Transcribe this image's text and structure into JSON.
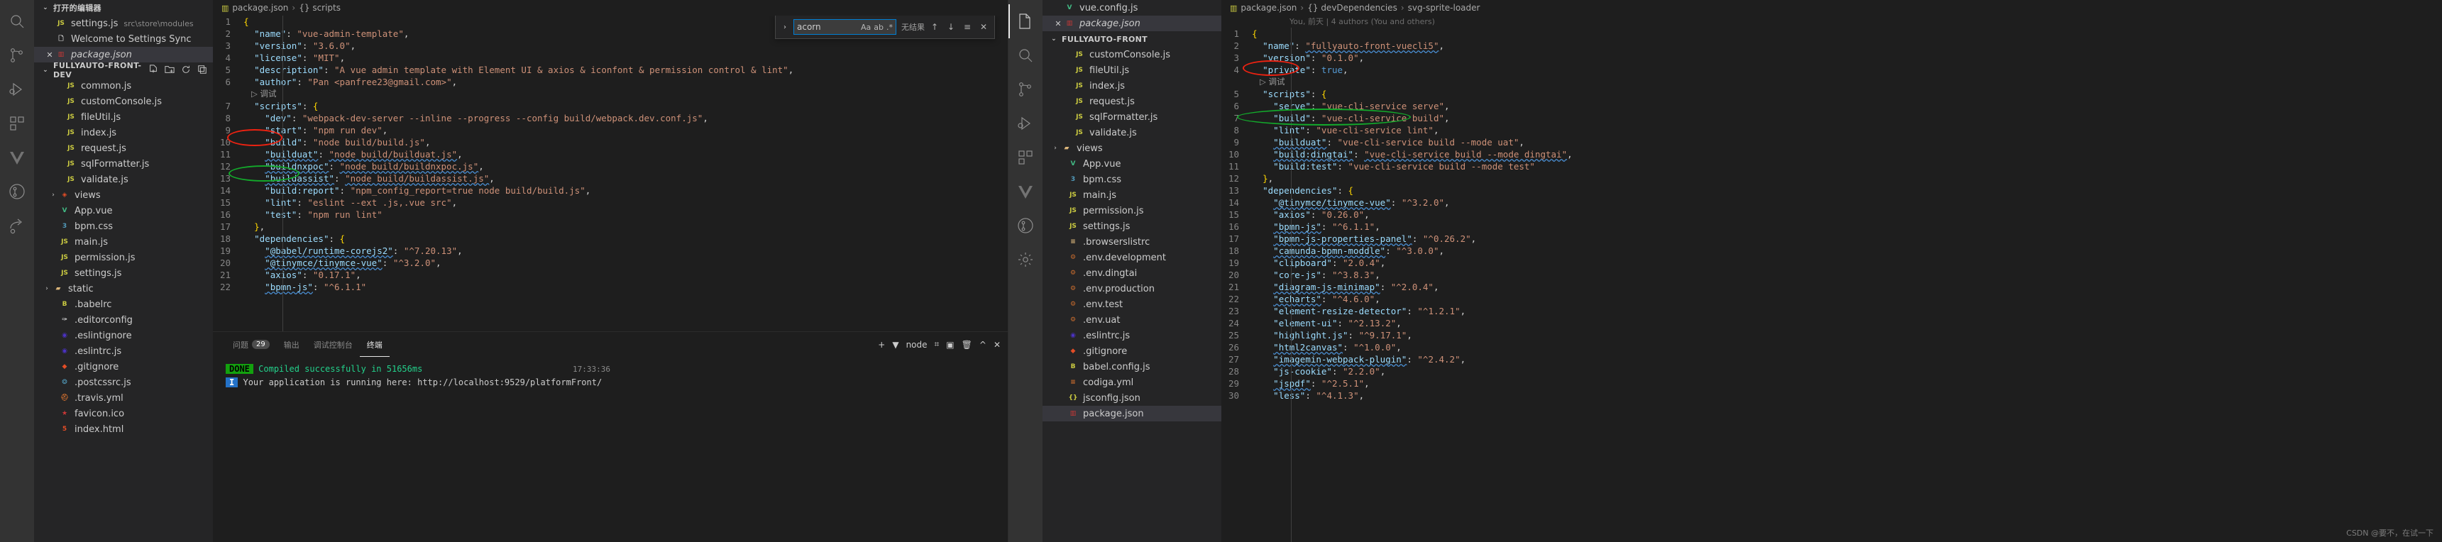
{
  "window_left": {
    "activity_icons": [
      "search-icon",
      "source-control-icon",
      "run-debug-icon",
      "extensions-icon",
      "vue-icon",
      "git-graph-icon",
      "share-icon"
    ],
    "explorer": {
      "open_editors_label": "打开的编辑器",
      "open_editors": [
        {
          "icon": "js-file-icon",
          "label": "settings.js",
          "detail": "src\\store\\modules",
          "selected": false,
          "close": ""
        },
        {
          "icon": "file-icon",
          "label": "Welcome to Settings Sync",
          "detail": "",
          "selected": false,
          "close": ""
        },
        {
          "icon": "npm-file-icon",
          "label": "package.json",
          "detail": "",
          "selected": true,
          "close": "✕",
          "italic": true
        }
      ],
      "project_label": "FULLYAUTO-FRONT-DEV",
      "files": [
        {
          "icon": "js-file-icon",
          "label": "common.js",
          "indent": 2
        },
        {
          "icon": "js-file-icon",
          "label": "customConsole.js",
          "indent": 2
        },
        {
          "icon": "js-file-icon",
          "label": "fileUtil.js",
          "indent": 2
        },
        {
          "icon": "js-file-icon",
          "label": "index.js",
          "indent": 2
        },
        {
          "icon": "js-file-icon",
          "label": "request.js",
          "indent": 2
        },
        {
          "icon": "js-file-icon",
          "label": "sqlFormatter.js",
          "indent": 2
        },
        {
          "icon": "js-file-icon",
          "label": "validate.js",
          "indent": 2
        },
        {
          "icon": "vue-folder-icon",
          "label": "views",
          "indent": 1,
          "chevron": "›"
        },
        {
          "icon": "vue-file-icon",
          "label": "App.vue",
          "indent": 1
        },
        {
          "icon": "css-file-icon",
          "label": "bpm.css",
          "indent": 1
        },
        {
          "icon": "js-file-icon",
          "label": "main.js",
          "indent": 1
        },
        {
          "icon": "js-file-icon",
          "label": "permission.js",
          "indent": 1
        },
        {
          "icon": "js-file-icon",
          "label": "settings.js",
          "indent": 1
        },
        {
          "icon": "folder-icon",
          "label": "static",
          "indent": 0,
          "chevron": "›"
        },
        {
          "icon": "babel-icon",
          "label": ".babelrc",
          "indent": 1
        },
        {
          "icon": "editorconfig-icon",
          "label": ".editorconfig",
          "indent": 1
        },
        {
          "icon": "eslint-icon",
          "label": ".eslintignore",
          "indent": 1
        },
        {
          "icon": "eslint-icon",
          "label": ".eslintrc.js",
          "indent": 1
        },
        {
          "icon": "git-icon",
          "label": ".gitignore",
          "indent": 1
        },
        {
          "icon": "postcss-icon",
          "label": ".postcssrc.js",
          "indent": 1
        },
        {
          "icon": "travis-icon",
          "label": ".travis.yml",
          "indent": 1
        },
        {
          "icon": "favicon-icon",
          "label": "favicon.ico",
          "indent": 1
        },
        {
          "icon": "html-icon",
          "label": "index.html",
          "indent": 1
        }
      ]
    },
    "editor": {
      "breadcrumb_file": "package.json",
      "breadcrumb_sep": "›",
      "breadcrumb_scope": "{} scripts",
      "codelens": "调试",
      "lines": [
        {
          "n": 1,
          "text": "{"
        },
        {
          "n": 2,
          "text": "  \"name\": \"vue-admin-template\","
        },
        {
          "n": 3,
          "text": "  \"version\": \"3.6.0\","
        },
        {
          "n": 4,
          "text": "  \"license\": \"MIT\","
        },
        {
          "n": 5,
          "text": "  \"description\": \"A vue admin template with Element UI & axios & iconfont & permission control & lint\","
        },
        {
          "n": 6,
          "text": "  \"author\": \"Pan <panfree23@gmail.com>\","
        },
        {
          "n": 7,
          "text": "  \"scripts\": {"
        },
        {
          "n": 8,
          "text": "    \"dev\": \"webpack-dev-server --inline --progress --config build/webpack.dev.conf.js\","
        },
        {
          "n": 9,
          "text": "    \"start\": \"npm run dev\","
        },
        {
          "n": 10,
          "text": "    \"build\": \"node build/build.js\","
        },
        {
          "n": 11,
          "text": "    \"builduat\": \"node build/builduat.js\","
        },
        {
          "n": 12,
          "text": "    \"buildnxpoc\": \"node build/buildnxpoc.js\","
        },
        {
          "n": 13,
          "text": "    \"buildassist\": \"node build/buildassist.js\","
        },
        {
          "n": 14,
          "text": "    \"build:report\": \"npm_config_report=true node build/build.js\","
        },
        {
          "n": 15,
          "text": "    \"lint\": \"eslint --ext .js,.vue src\","
        },
        {
          "n": 16,
          "text": "    \"test\": \"npm run lint\""
        },
        {
          "n": 17,
          "text": "  },"
        },
        {
          "n": 18,
          "text": "  \"dependencies\": {"
        },
        {
          "n": 19,
          "text": "    \"@babel/runtime-corejs2\": \"^7.20.13\","
        },
        {
          "n": 20,
          "text": "    \"@tinymce/tinymce-vue\": \"^3.2.0\","
        },
        {
          "n": 21,
          "text": "    \"axios\": \"0.17.1\","
        },
        {
          "n": 22,
          "text": "    \"bpmn-js\": \"^6.1.1\""
        }
      ]
    },
    "find_widget": {
      "chevron": "›",
      "query": "acorn",
      "match_case": "Aa",
      "whole_word": "ab",
      "regex": ".*",
      "result_text": "无结果",
      "prev": "↑",
      "next": "↓",
      "selection_only": "≡",
      "close": "✕"
    },
    "panel": {
      "tabs": [
        {
          "label": "问题",
          "badge": "29",
          "active": false
        },
        {
          "label": "输出",
          "badge": "",
          "active": false
        },
        {
          "label": "调试控制台",
          "badge": "",
          "active": false
        },
        {
          "label": "终端",
          "badge": "",
          "active": true
        }
      ],
      "actions": [
        "+",
        "▼",
        "node",
        "⌗",
        "▣",
        "🗑",
        "^",
        "✕"
      ],
      "shell_name": "node",
      "lines": [
        {
          "chip": "DONE",
          "chip_color": "#13a10e",
          "text": "Compiled successfully in 51656ms",
          "text_color": "#23d18b",
          "right": "17:33:36"
        },
        {
          "chip": "I",
          "chip_color": "#2472c8",
          "text": "Your application is running here: http://localhost:9529/platformFront/",
          "text_color": "#cccccc",
          "right": ""
        },
        {
          "chip": "",
          "chip_color": "",
          "text": "",
          "text_color": "#cccccc",
          "right": ""
        }
      ]
    }
  },
  "window_right": {
    "activity_icons": [
      "files-icon",
      "search-icon",
      "source-control-icon",
      "run-debug-icon",
      "extensions-icon",
      "vue-icon",
      "git-graph-icon",
      "settings-gear-icon"
    ],
    "explorer": {
      "open_editors": [
        {
          "icon": "vue-file-icon",
          "label": "vue.config.js",
          "selected": false,
          "close": ""
        },
        {
          "icon": "npm-file-icon",
          "label": "package.json",
          "selected": true,
          "close": "✕",
          "italic": true
        }
      ],
      "project_label": "FULLYAUTO-FRONT",
      "files": [
        {
          "icon": "js-file-icon",
          "label": "customConsole.js",
          "indent": 2
        },
        {
          "icon": "js-file-icon",
          "label": "fileUtil.js",
          "indent": 2
        },
        {
          "icon": "js-file-icon",
          "label": "index.js",
          "indent": 2
        },
        {
          "icon": "js-file-icon",
          "label": "request.js",
          "indent": 2
        },
        {
          "icon": "js-file-icon",
          "label": "sqlFormatter.js",
          "indent": 2
        },
        {
          "icon": "js-file-icon",
          "label": "validate.js",
          "indent": 2
        },
        {
          "icon": "folder-icon",
          "label": "views",
          "indent": 0,
          "chevron": "›"
        },
        {
          "icon": "vue-file-icon",
          "label": "App.vue",
          "indent": 1
        },
        {
          "icon": "css-file-icon",
          "label": "bpm.css",
          "indent": 1
        },
        {
          "icon": "js-file-icon",
          "label": "main.js",
          "indent": 1
        },
        {
          "icon": "js-file-icon",
          "label": "permission.js",
          "indent": 1
        },
        {
          "icon": "js-file-icon",
          "label": "settings.js",
          "indent": 1
        },
        {
          "icon": "browserslist-icon",
          "label": ".browserslistrc",
          "indent": 1
        },
        {
          "icon": "env-icon",
          "label": ".env.development",
          "indent": 1
        },
        {
          "icon": "env-icon",
          "label": ".env.dingtai",
          "indent": 1
        },
        {
          "icon": "env-icon",
          "label": ".env.production",
          "indent": 1
        },
        {
          "icon": "env-icon",
          "label": ".env.test",
          "indent": 1
        },
        {
          "icon": "env-icon",
          "label": ".env.uat",
          "indent": 1
        },
        {
          "icon": "eslint-icon",
          "label": ".eslintrc.js",
          "indent": 1
        },
        {
          "icon": "git-icon",
          "label": ".gitignore",
          "indent": 1
        },
        {
          "icon": "babel-icon",
          "label": "babel.config.js",
          "indent": 1
        },
        {
          "icon": "yml-icon",
          "label": "codiga.yml",
          "indent": 1
        },
        {
          "icon": "json-icon",
          "label": "jsconfig.json",
          "indent": 1
        },
        {
          "icon": "npm-file-icon",
          "label": "package.json",
          "indent": 1,
          "selected": true
        }
      ]
    },
    "editor": {
      "breadcrumb_file": "package.json",
      "breadcrumb_sep": "›",
      "breadcrumb_scope": "{} devDependencies",
      "breadcrumb_scope2": "svg-sprite-loader",
      "authors": "You, 前天 | 4 authors (You and others)",
      "codelens": "调试",
      "lines": [
        {
          "n": 1,
          "text": "{"
        },
        {
          "n": 2,
          "text": "  \"name\": \"fullyauto-front-vuecli5\","
        },
        {
          "n": 3,
          "text": "  \"version\": \"0.1.0\","
        },
        {
          "n": 4,
          "text": "  \"private\": true,"
        },
        {
          "n": 5,
          "text": "  \"scripts\": {"
        },
        {
          "n": 6,
          "text": "    \"serve\": \"vue-cli-service serve\","
        },
        {
          "n": 7,
          "text": "    \"build\": \"vue-cli-service build\","
        },
        {
          "n": 8,
          "text": "    \"lint\": \"vue-cli-service lint\","
        },
        {
          "n": 9,
          "text": "    \"builduat\": \"vue-cli-service build --mode uat\","
        },
        {
          "n": 10,
          "text": "    \"build:dingtai\": \"vue-cli-service build --mode dingtai\","
        },
        {
          "n": 11,
          "text": "    \"build:test\": \"vue-cli-service build --mode test\""
        },
        {
          "n": 12,
          "text": "  },"
        },
        {
          "n": 13,
          "text": "  \"dependencies\": {"
        },
        {
          "n": 14,
          "text": "    \"@tinymce/tinymce-vue\": \"^3.2.0\","
        },
        {
          "n": 15,
          "text": "    \"axios\": \"0.26.0\","
        },
        {
          "n": 16,
          "text": "    \"bpmn-js\": \"^6.1.1\","
        },
        {
          "n": 17,
          "text": "    \"bpmn-js-properties-panel\": \"^0.26.2\","
        },
        {
          "n": 18,
          "text": "    \"camunda-bpmn-moddle\": \"^3.0.0\","
        },
        {
          "n": 19,
          "text": "    \"clipboard\": \"2.0.4\","
        },
        {
          "n": 20,
          "text": "    \"core-js\": \"^3.8.3\","
        },
        {
          "n": 21,
          "text": "    \"diagram-js-minimap\": \"^2.0.4\","
        },
        {
          "n": 22,
          "text": "    \"echarts\": \"^4.6.0\","
        },
        {
          "n": 23,
          "text": "    \"element-resize-detector\": \"^1.2.1\","
        },
        {
          "n": 24,
          "text": "    \"element-ui\": \"^2.13.2\","
        },
        {
          "n": 25,
          "text": "    \"highlight.js\": \"^9.17.1\","
        },
        {
          "n": 26,
          "text": "    \"html2canvas\": \"^1.0.0\","
        },
        {
          "n": 27,
          "text": "    \"imagemin-webpack-plugin\": \"^2.4.2\","
        },
        {
          "n": 28,
          "text": "    \"js-cookie\": \"2.2.0\","
        },
        {
          "n": 29,
          "text": "    \"jspdf\": \"^2.5.1\","
        },
        {
          "n": 30,
          "text": "    \"less\": \"^4.1.3\","
        }
      ]
    }
  },
  "annotations": [
    {
      "id": "red-dev",
      "shape": "ellipse",
      "color": "#ee2211"
    },
    {
      "id": "green-builduat",
      "shape": "ellipse",
      "color": "#13aa2b"
    },
    {
      "id": "red-scripts",
      "shape": "ellipse",
      "color": "#ee2211"
    },
    {
      "id": "green-builduat-right",
      "shape": "ellipse",
      "color": "#13aa2b"
    }
  ],
  "watermark": "CSDN @要不，在试一下"
}
